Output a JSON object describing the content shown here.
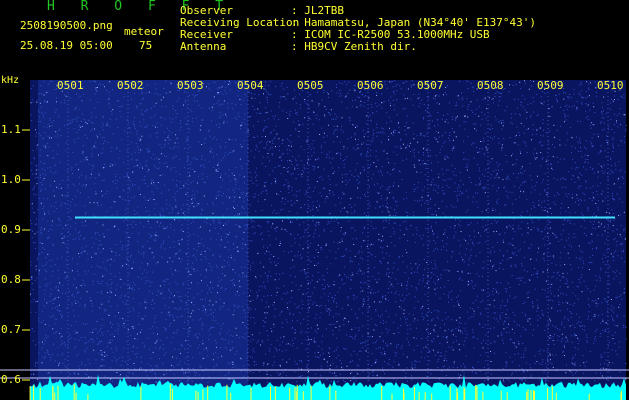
{
  "header": {
    "title": "H R O F F T",
    "filename": "2508190500.png",
    "mode": "meteor",
    "datetime": "25.08.19 05:00",
    "count": "75",
    "info": [
      {
        "label": "Observer",
        "value": ": JL2TBB"
      },
      {
        "label": "Receiving Location",
        "value": ": Hamamatsu, Japan (N34°40' E137°43')"
      },
      {
        "label": "Receiver",
        "value": ": ICOM IC-R2500 53.1000MHz USB"
      },
      {
        "label": "Antenna",
        "value": ": HB9CV Zenith dir."
      }
    ]
  },
  "spectrogram": {
    "yunit": "kHz",
    "y_ticks": [
      "1.1",
      "1.0",
      "0.9",
      "0.8",
      "0.7",
      "0.6"
    ],
    "x_ticks": [
      "0501",
      "0502",
      "0503",
      "0504",
      "0505",
      "0506",
      "0507",
      "0508",
      "0509",
      "0510"
    ],
    "carrier_khz": 0.925,
    "colors": {
      "background": "#000000",
      "noise": "#1a2a9a",
      "carrier": "#40e0ff",
      "text": "#ffff33",
      "title": "#22c722",
      "baseline": "#00ffff"
    }
  }
}
